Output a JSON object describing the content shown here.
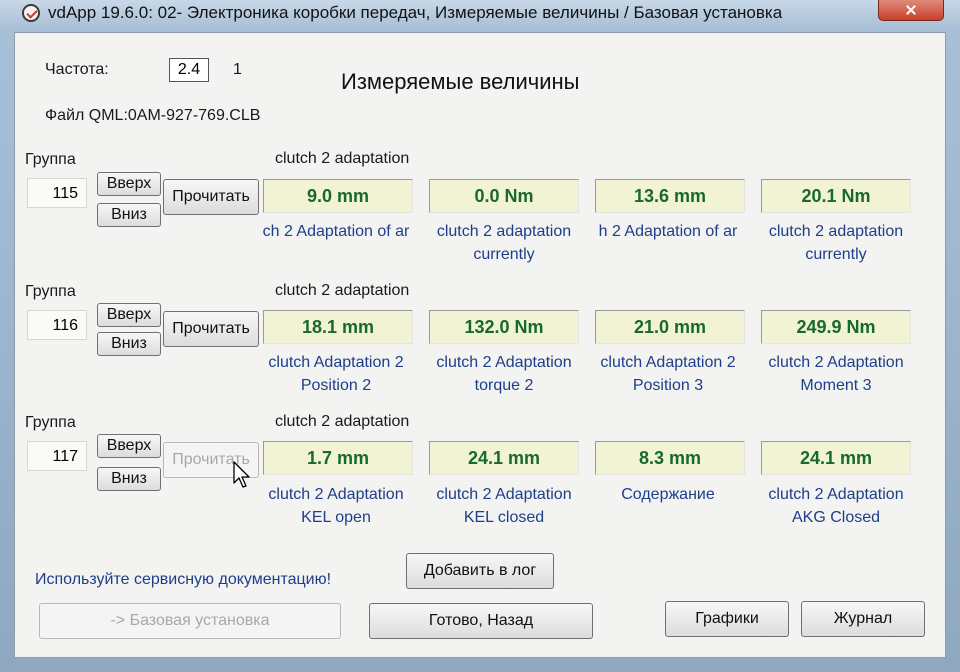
{
  "window": {
    "title": "vdApp 19.6.0: 02- Электроника коробки передач,  Измеряемые величины / Базовая установка"
  },
  "header": {
    "freq_label": "Частота:",
    "freq_value": "2.4",
    "freq_extra": "1",
    "heading": "Измеряемые величины",
    "file_label": "Файл QML:0AM-927-769.CLB"
  },
  "groups": [
    {
      "label": "Группа",
      "number": "115",
      "up_label": "Вверх",
      "down_label": "Вниз",
      "read_label": "Прочитать",
      "title": "clutch 2 adaptation",
      "values": [
        "9.0 mm",
        "0.0 Nm",
        "13.6 mm",
        "20.1 Nm"
      ],
      "descs": [
        [
          "ch 2 Adaptation of ar",
          ""
        ],
        [
          "clutch 2 adaptation",
          "currently"
        ],
        [
          "h 2 Adaptation of ar",
          ""
        ],
        [
          "clutch 2 adaptation",
          "currently"
        ]
      ]
    },
    {
      "label": "Группа",
      "number": "116",
      "up_label": "Вверх",
      "down_label": "Вниз",
      "read_label": "Прочитать",
      "title": "clutch 2 adaptation",
      "values": [
        "18.1 mm",
        "132.0 Nm",
        "21.0 mm",
        "249.9 Nm"
      ],
      "descs": [
        [
          "clutch Adaptation 2",
          "Position 2"
        ],
        [
          "clutch 2 Adaptation",
          "torque 2"
        ],
        [
          "clutch Adaptation 2",
          "Position 3"
        ],
        [
          "clutch 2 Adaptation",
          "Moment 3"
        ]
      ]
    },
    {
      "label": "Группа",
      "number": "117",
      "up_label": "Вверх",
      "down_label": "Вниз",
      "read_label": "Прочитать",
      "title": "clutch 2 adaptation",
      "values": [
        "1.7 mm",
        "24.1 mm",
        "8.3 mm",
        "24.1 mm"
      ],
      "descs": [
        [
          "clutch 2 Adaptation",
          "KEL open"
        ],
        [
          "clutch 2 Adaptation",
          "KEL closed"
        ],
        [
          "Содержание",
          ""
        ],
        [
          "clutch 2 Adaptation",
          "AKG Closed"
        ]
      ]
    }
  ],
  "footer": {
    "note": "Используйте сервисную документацию!",
    "add_log": "Добавить в лог",
    "basic_setting": "-> Базовая установка",
    "done_back": "Готово, Назад",
    "graphs": "Графики",
    "journal": "Журнал"
  }
}
